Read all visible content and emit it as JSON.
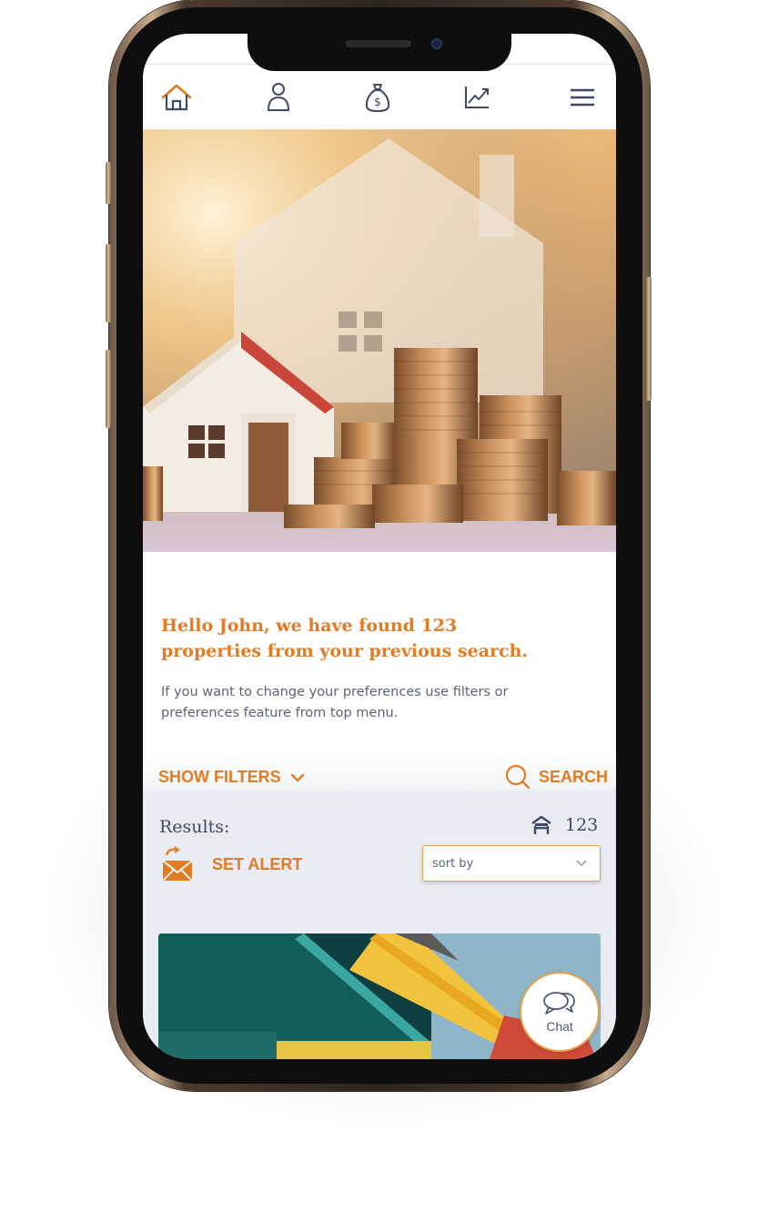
{
  "nav": {
    "items": [
      {
        "icon": "home-icon",
        "active": true
      },
      {
        "icon": "user-icon",
        "active": false
      },
      {
        "icon": "money-bag-icon",
        "active": false
      },
      {
        "icon": "chart-icon",
        "active": false
      },
      {
        "icon": "menu-icon",
        "active": false
      }
    ]
  },
  "greeting": {
    "line1": "Hello John, we have found 123",
    "line2": "properties from your previous search."
  },
  "subtext": {
    "line1": "If you want to change your preferences use  filters or",
    "line2": "preferences feature from top menu."
  },
  "filters": {
    "show_label": "SHOW FILTERS",
    "search_label": "SEARCH"
  },
  "results": {
    "label": "Results:",
    "count": "123",
    "set_alert_label": "SET ALERT",
    "sort_placeholder": "sort by"
  },
  "chat": {
    "label": "Chat"
  },
  "colors": {
    "accent": "#e37b22",
    "text": "#3d4a66",
    "panel": "#eaecf3"
  }
}
